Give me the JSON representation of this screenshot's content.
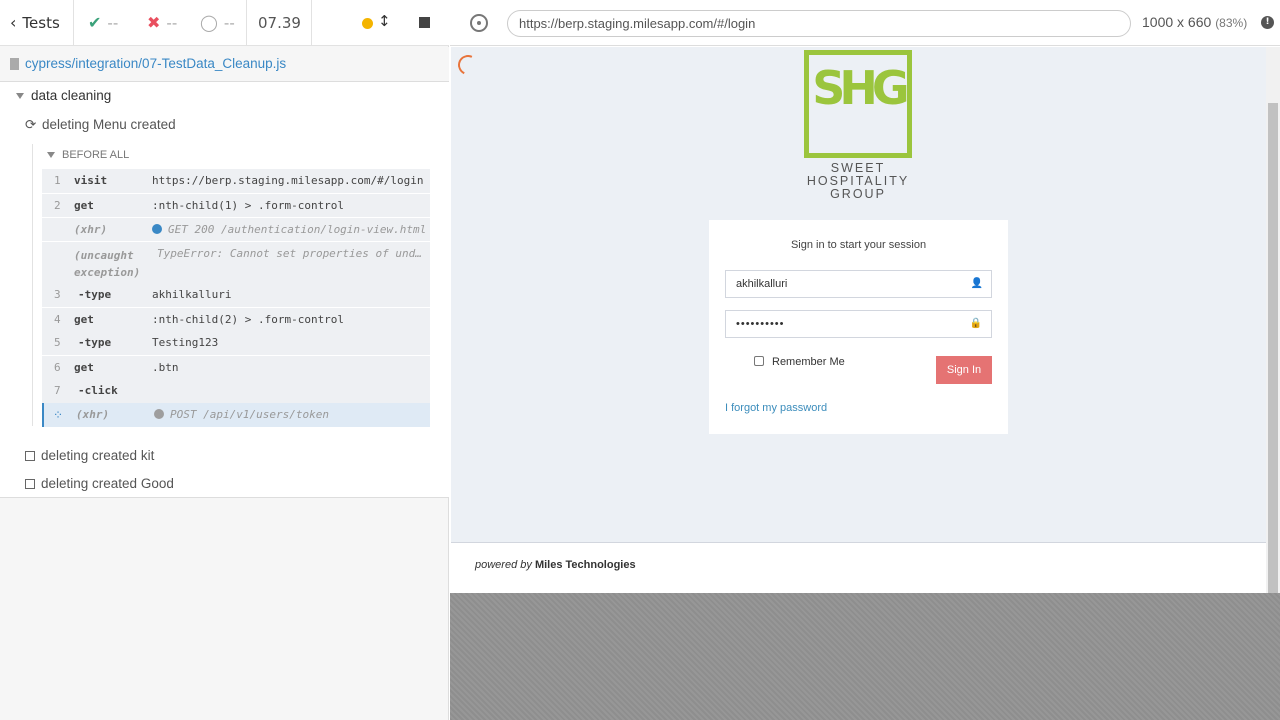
{
  "stats": {
    "tests_label": "Tests",
    "passed": "--",
    "failed": "--",
    "pending": "--",
    "duration": "07.39"
  },
  "spec_path": "cypress/integration/07-TestData_Cleanup.js",
  "suite": {
    "title": "data cleaning",
    "tests": [
      {
        "title": "deleting Menu created",
        "state": "running"
      },
      {
        "title": "deleting created kit",
        "state": "not-run"
      },
      {
        "title": "deleting created Good",
        "state": "not-run"
      }
    ]
  },
  "hook": {
    "title": "BEFORE ALL",
    "commands": [
      {
        "num": "1",
        "name": "visit",
        "message": "https://berp.staging.milesapp.com/#/login"
      },
      {
        "num": "2",
        "name": "get",
        "message": ":nth-child(1) > .form-control"
      },
      {
        "num": "",
        "name": "(xhr)",
        "message": "GET 200 /authentication/login-view.html",
        "dot": "#3a88c5"
      },
      {
        "num": "",
        "name": "(uncaught exception)",
        "message": "TypeError: Cannot set properties of undefined"
      },
      {
        "num": "3",
        "name": "-type",
        "message": "akhilkalluri"
      },
      {
        "num": "4",
        "name": "get",
        "message": ":nth-child(2) > .form-control"
      },
      {
        "num": "5",
        "name": "-type",
        "message": "Testing123"
      },
      {
        "num": "6",
        "name": "get",
        "message": ".btn"
      },
      {
        "num": "7",
        "name": "-click",
        "message": ""
      },
      {
        "num": "",
        "name": "(xhr)",
        "message": "POST /api/v1/users/token",
        "dot": "#9e9e9e"
      }
    ]
  },
  "aut": {
    "url": "https://berp.staging.milesapp.com/#/login",
    "viewport": "1000 x 660",
    "scale": "(83%)"
  },
  "app": {
    "logo_letters": "SHG",
    "logo_line1": "SWEET",
    "logo_line2": "HOSPITALITY",
    "logo_line3": "GROUP",
    "login_msg": "Sign in to start your session",
    "username_value": "akhilkalluri",
    "password_value": "••••••••••",
    "remember_label": "Remember Me",
    "signin_label": "Sign In",
    "forgot_label": "I forgot my password",
    "powered_prefix": "powered by",
    "powered_company": "Miles Technologies",
    "brand_color": "#9bc53d",
    "button_color": "#e57373"
  }
}
